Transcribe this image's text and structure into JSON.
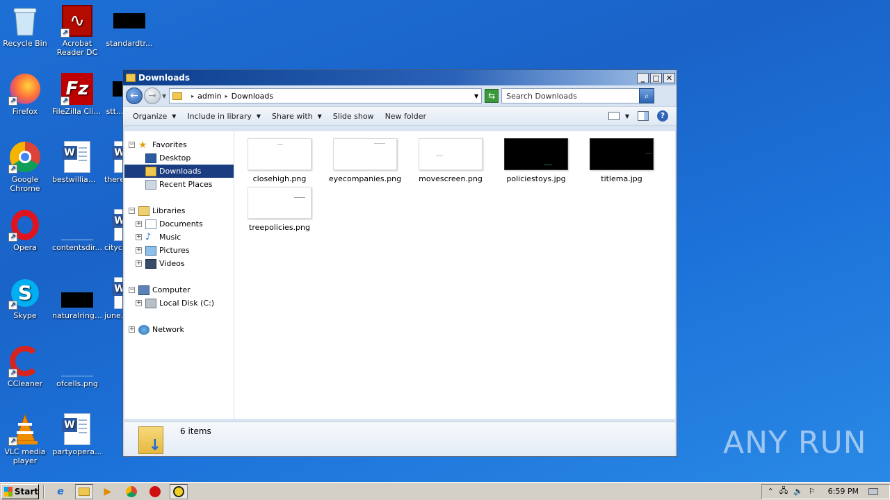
{
  "desktop": {
    "icons": [
      {
        "label": "Recycle Bin"
      },
      {
        "label": "Acrobat Reader DC"
      },
      {
        "label": "standardtr..."
      },
      {
        "label": "Firefox"
      },
      {
        "label": "FileZilla Client"
      },
      {
        "label": "stt..."
      },
      {
        "label": "Google Chrome"
      },
      {
        "label": "bestwilliam.rtf"
      },
      {
        "label": "there..."
      },
      {
        "label": "Opera"
      },
      {
        "label": "contentsdir..."
      },
      {
        "label": "cityc..."
      },
      {
        "label": "Skype"
      },
      {
        "label": "naturalringt..."
      },
      {
        "label": "june..."
      },
      {
        "label": "CCleaner"
      },
      {
        "label": "ofcells.png"
      },
      {
        "label": "VLC media player"
      },
      {
        "label": "partyopera..."
      }
    ]
  },
  "window": {
    "title": "Downloads",
    "address": {
      "segments": [
        "admin",
        "Downloads"
      ]
    },
    "search_placeholder": "Search Downloads",
    "toolbar": {
      "organize": "Organize",
      "include_in_library": "Include in library",
      "share_with": "Share with",
      "slide_show": "Slide show",
      "new_folder": "New folder"
    },
    "nav": {
      "favorites": "Favorites",
      "desktop": "Desktop",
      "downloads": "Downloads",
      "recent_places": "Recent Places",
      "libraries": "Libraries",
      "documents": "Documents",
      "music": "Music",
      "pictures": "Pictures",
      "videos": "Videos",
      "computer": "Computer",
      "local_disk": "Local Disk (C:)",
      "network": "Network"
    },
    "files": [
      {
        "name": "closehigh.png",
        "dark": false
      },
      {
        "name": "eyecompanies.png",
        "dark": false
      },
      {
        "name": "movescreen.png",
        "dark": false
      },
      {
        "name": "policiestoys.jpg",
        "dark": true
      },
      {
        "name": "titlema.jpg",
        "dark": true
      },
      {
        "name": "treepolicies.png",
        "dark": false
      }
    ],
    "status": {
      "items": "6 items"
    }
  },
  "watermark": "ANY RUN",
  "taskbar": {
    "start": "Start",
    "clock": "6:59 PM"
  }
}
